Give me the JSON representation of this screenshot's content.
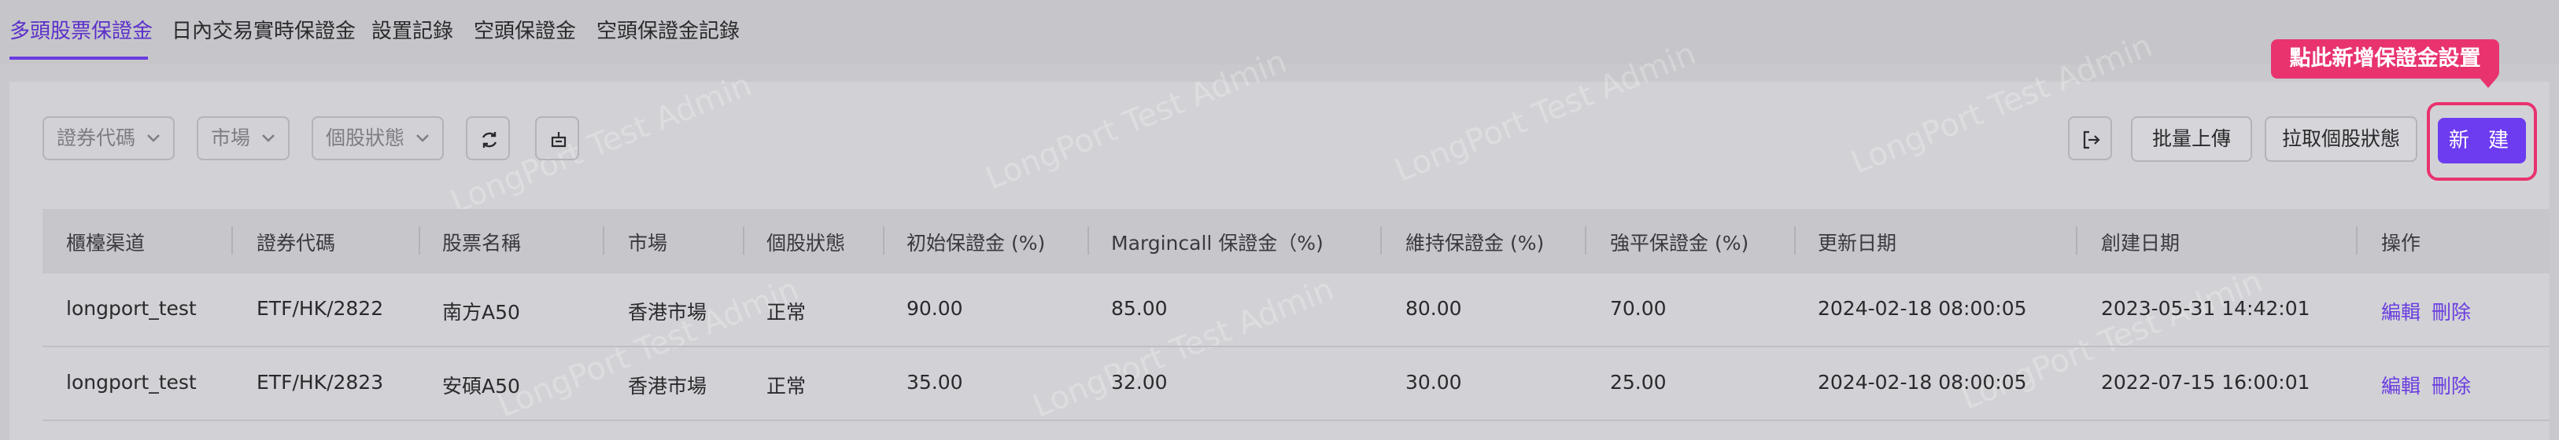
{
  "tabs": [
    {
      "label": "多頭股票保證金",
      "active": true
    },
    {
      "label": "日內交易實時保證金",
      "active": false
    },
    {
      "label": "設置記錄",
      "active": false
    },
    {
      "label": "空頭保證金",
      "active": false
    },
    {
      "label": "空頭保證金記錄",
      "active": false
    }
  ],
  "filters": {
    "security_code": "證券代碼",
    "market": "市場",
    "stock_status": "個股狀態"
  },
  "icons": {
    "refresh": "refresh-icon",
    "clear": "clear-icon",
    "export": "export-icon",
    "dropdown": "chevron-down-icon"
  },
  "actions": {
    "bulk_upload": "批量上傳",
    "pull_status": "拉取個股狀態",
    "new": "新 建"
  },
  "callout": "點此新增保證金設置",
  "watermark": "LongPort Test Admin",
  "table": {
    "headers": [
      "櫃檯渠道",
      "證券代碼",
      "股票名稱",
      "市場",
      "個股狀態",
      "初始保證金 (%)",
      "Margincall 保證金（%)",
      "維持保證金 (%)",
      "強平保證金 (%)",
      "更新日期",
      "創建日期",
      "操作"
    ],
    "rows": [
      [
        "longport_test",
        "ETF/HK/2822",
        "南方A50",
        "香港市場",
        "正常",
        "90.00",
        "85.00",
        "80.00",
        "70.00",
        "2024-02-18 08:00:05",
        "2023-05-31 14:42:01"
      ],
      [
        "longport_test",
        "ETF/HK/2823",
        "安碩A50",
        "香港市場",
        "正常",
        "35.00",
        "32.00",
        "30.00",
        "25.00",
        "2024-02-18 08:00:05",
        "2022-07-15 16:00:01"
      ]
    ],
    "row_actions": {
      "edit": "編輯",
      "delete": "刪除"
    }
  },
  "colors": {
    "accent": "#6d3cf0",
    "callout": "#e8336f",
    "link": "#6a3de0"
  }
}
